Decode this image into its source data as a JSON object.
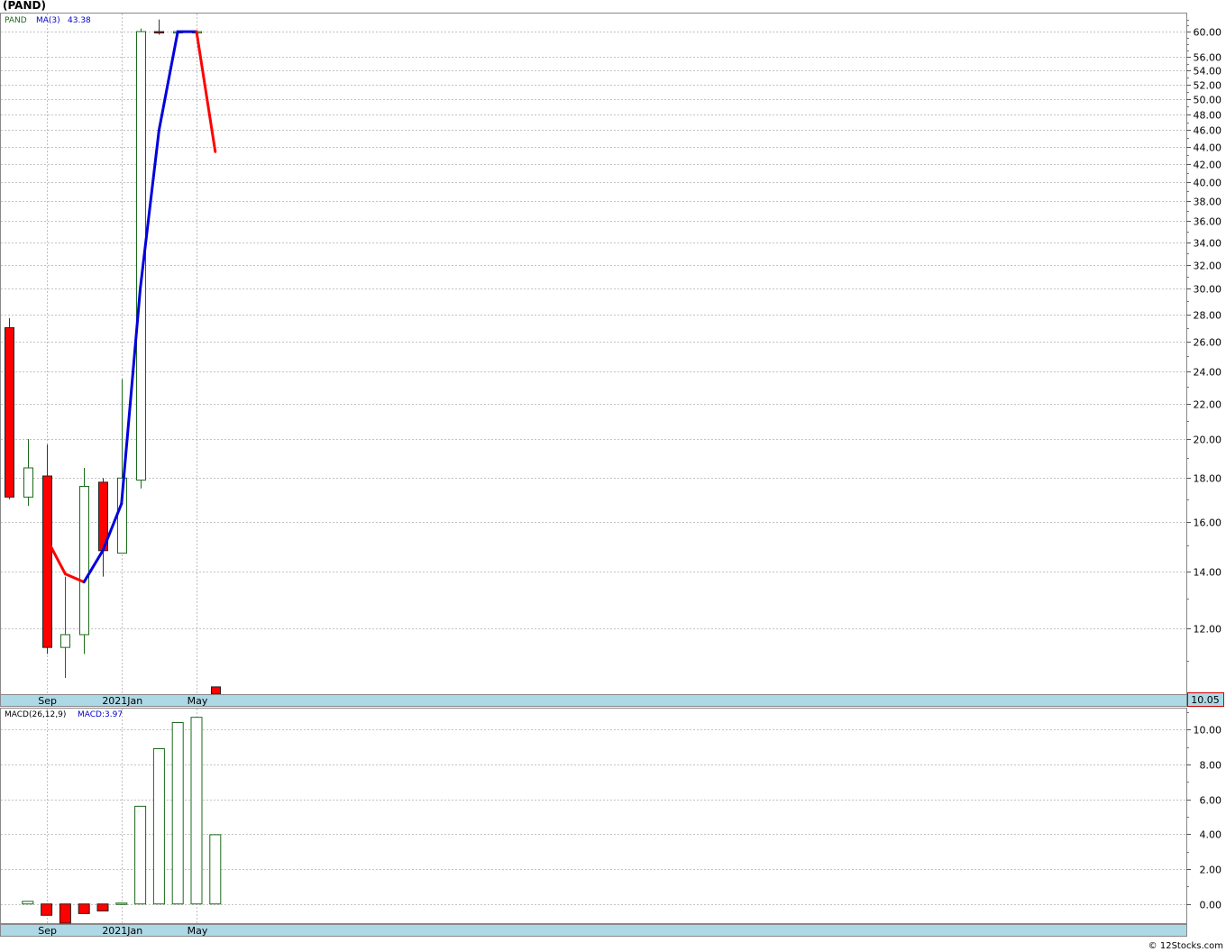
{
  "header": {
    "title": "(PAND)",
    "ticker_label": "PAND",
    "ma_label": "MA(3)",
    "ma_value": "43.38",
    "last_price": "10.05"
  },
  "macd_header": {
    "label": "MACD(26,12,9)",
    "value": "MACD:3.97"
  },
  "footer": {
    "copyright": "© 12Stocks.com"
  },
  "colors": {
    "up_candle": "#1a6b1a",
    "down_candle": "#ff0000",
    "ma_up": "#0000dd",
    "ma_down": "#ff0000",
    "axis_band": "#add8e6",
    "grid": "#b0b0b0"
  },
  "chart_data": [
    {
      "type": "candlestick",
      "scale": "log",
      "ylim": [
        10.05,
        63
      ],
      "y_ticks": [
        60,
        56,
        54,
        52,
        50,
        48,
        46,
        44,
        42,
        40,
        38,
        36,
        34,
        32,
        30,
        28,
        26,
        24,
        22,
        20,
        18,
        16,
        14,
        12
      ],
      "x_ticks": [
        {
          "label": "Sep",
          "index": 2
        },
        {
          "label": "2021Jan",
          "index": 6
        },
        {
          "label": "May",
          "index": 10
        }
      ],
      "candles": [
        {
          "open": 27.0,
          "high": 27.7,
          "low": 17.0,
          "close": 17.1
        },
        {
          "open": 17.1,
          "high": 20.0,
          "low": 16.7,
          "close": 18.5
        },
        {
          "open": 18.1,
          "high": 19.7,
          "low": 11.2,
          "close": 11.4
        },
        {
          "open": 11.4,
          "high": 13.8,
          "low": 10.5,
          "close": 11.8
        },
        {
          "open": 11.8,
          "high": 18.5,
          "low": 11.2,
          "close": 17.6
        },
        {
          "open": 17.8,
          "high": 18.0,
          "low": 13.8,
          "close": 14.8
        },
        {
          "open": 14.7,
          "high": 23.5,
          "low": 14.7,
          "close": 18.0
        },
        {
          "open": 17.9,
          "high": 60.5,
          "low": 17.5,
          "close": 60.0
        },
        {
          "open": 60.0,
          "high": 62.0,
          "low": 59.5,
          "close": 59.8
        },
        {
          "open": 60.0,
          "high": 60.0,
          "low": 60.0,
          "close": 60.0
        },
        {
          "open": 60.0,
          "high": 60.0,
          "low": 60.0,
          "close": 60.0
        },
        {
          "open": 10.25,
          "high": 10.25,
          "low": 10.05,
          "close": 10.05
        }
      ],
      "ma": [
        null,
        null,
        15.3,
        13.9,
        13.6,
        14.8,
        16.8,
        30.0,
        46.0,
        60.0,
        60.0,
        43.4
      ]
    },
    {
      "type": "bar",
      "series": [
        {
          "name": "MACD(26,12,9)",
          "values": [
            0,
            0.15,
            -0.65,
            -1.1,
            -0.55,
            -0.4,
            0.05,
            5.6,
            8.9,
            10.4,
            10.7,
            3.97
          ]
        }
      ],
      "ylim": [
        -1.1,
        11.2
      ],
      "y_ticks": [
        10,
        8,
        6,
        4,
        2,
        0
      ],
      "x_ticks": [
        {
          "label": "Sep",
          "index": 2
        },
        {
          "label": "2021Jan",
          "index": 6
        },
        {
          "label": "May",
          "index": 10
        }
      ]
    }
  ]
}
